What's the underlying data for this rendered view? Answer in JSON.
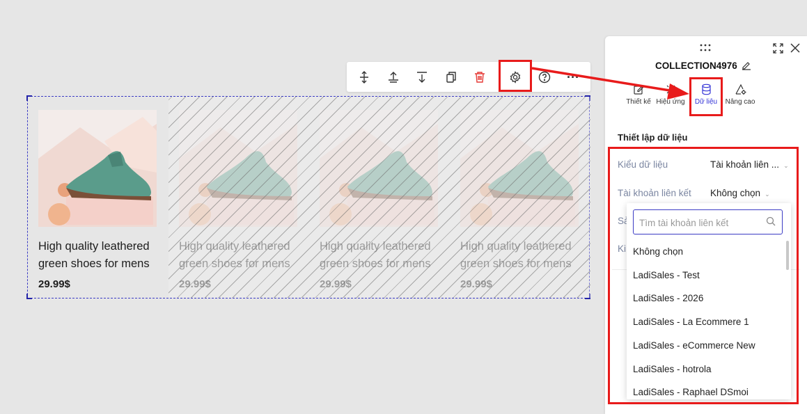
{
  "toolbar": {
    "buttons": [
      "move-up-down-icon",
      "move-top-icon",
      "move-bottom-icon",
      "duplicate-icon",
      "delete-icon",
      "settings-icon",
      "help-icon",
      "more-icon"
    ],
    "more_label": "···"
  },
  "products": [
    {
      "title": "High quality leathered green shoes for mens",
      "price": "29.99$"
    },
    {
      "title": "High quality leathered green shoes for mens",
      "price": "29.99$"
    },
    {
      "title": "High quality leathered green shoes for mens",
      "price": "29.99$"
    },
    {
      "title": "High quality leathered green shoes for mens",
      "price": "29.99$"
    }
  ],
  "panel": {
    "drag_handle": "⋮⋮",
    "title": "COLLECTION4976",
    "tabs": [
      {
        "label": "Thiết kế"
      },
      {
        "label": "Hiệu ứng"
      },
      {
        "label": "Dữ liệu"
      },
      {
        "label": "Nâng cao"
      }
    ],
    "section_title": "Thiết lập dữ liệu",
    "fields": {
      "data_type": {
        "label": "Kiểu dữ liệu",
        "value": "Tài khoản liên ..."
      },
      "linked_account": {
        "label": "Tài khoản liên kết",
        "value": "Không chọn"
      },
      "hidden_row_1": {
        "label": "Sả"
      },
      "hidden_row_2": {
        "label": "Ki"
      }
    }
  },
  "dropdown": {
    "search_placeholder": "Tìm tài khoản liên kết",
    "items": [
      "Không chọn",
      "LadiSales - Test",
      "LadiSales - 2026",
      "LadiSales - La Ecommere 1",
      "LadiSales - eCommerce New",
      "LadiSales - hotrola",
      "LadiSales - Raphael DSmoi"
    ]
  },
  "colors": {
    "accent": "#3232d6",
    "annotation": "#e81b1b",
    "delete": "#e53935"
  }
}
